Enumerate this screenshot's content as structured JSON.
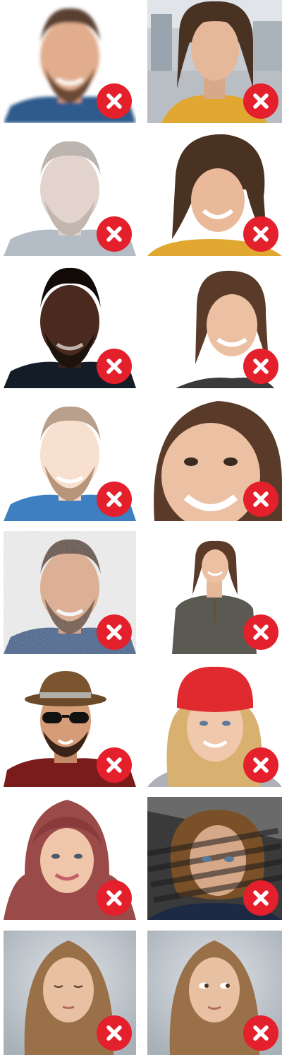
{
  "tiles": [
    {
      "id": "man-blurred",
      "status": "rejected",
      "status_icon": "cross-icon"
    },
    {
      "id": "woman-office-bg",
      "status": "rejected",
      "status_icon": "cross-icon"
    },
    {
      "id": "man-washed-out",
      "status": "rejected",
      "status_icon": "cross-icon"
    },
    {
      "id": "woman-looking-down",
      "status": "rejected",
      "status_icon": "cross-icon"
    },
    {
      "id": "man-dark",
      "status": "rejected",
      "status_icon": "cross-icon"
    },
    {
      "id": "woman-too-small",
      "status": "rejected",
      "status_icon": "cross-icon"
    },
    {
      "id": "man-overexposed",
      "status": "rejected",
      "status_icon": "cross-icon"
    },
    {
      "id": "woman-too-close",
      "status": "rejected",
      "status_icon": "cross-icon"
    },
    {
      "id": "man-noisy",
      "status": "rejected",
      "status_icon": "cross-icon"
    },
    {
      "id": "woman-full-body",
      "status": "rejected",
      "status_icon": "cross-icon"
    },
    {
      "id": "man-hat-sunglasses",
      "status": "rejected",
      "status_icon": "cross-icon"
    },
    {
      "id": "woman-red-beanie",
      "status": "rejected",
      "status_icon": "cross-icon"
    },
    {
      "id": "woman-headscarf",
      "status": "rejected",
      "status_icon": "cross-icon"
    },
    {
      "id": "girl-shadow-stripes",
      "status": "rejected",
      "status_icon": "cross-icon"
    },
    {
      "id": "woman-eyes-closed",
      "status": "rejected",
      "status_icon": "cross-icon"
    },
    {
      "id": "woman-eyes-sideways",
      "status": "rejected",
      "status_icon": "cross-icon"
    }
  ],
  "colors": {
    "badge": "#e3202c",
    "badge_icon": "#ffffff",
    "page_background": "#ffffff"
  }
}
